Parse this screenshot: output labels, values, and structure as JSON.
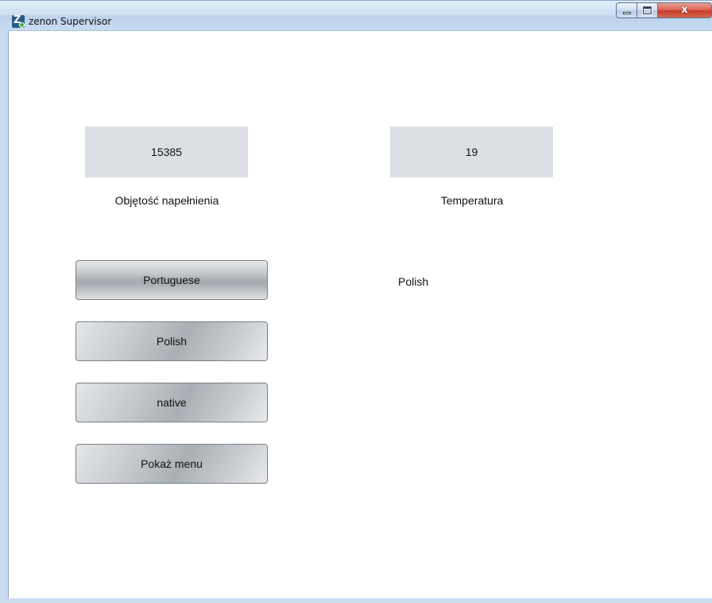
{
  "window": {
    "title": "zenon Supervisor",
    "icon": "zenon-app-icon",
    "controls": {
      "minimize_icon": "minimize-icon",
      "maximize_icon": "maximize-icon",
      "close_label": "x"
    }
  },
  "values": [
    {
      "value": "15385",
      "label": "Objętość napełnienia"
    },
    {
      "value": "19",
      "label": "Temperatura"
    }
  ],
  "language_buttons": [
    {
      "label": "Portuguese"
    },
    {
      "label": "Polish"
    },
    {
      "label": "native"
    },
    {
      "label": "Pokaż menu"
    }
  ],
  "current_language": "Polish",
  "colors": {
    "value_box_bg": "#dcdfe3",
    "close_button": "#c43a28",
    "titlebar": "#cfe0f3"
  }
}
